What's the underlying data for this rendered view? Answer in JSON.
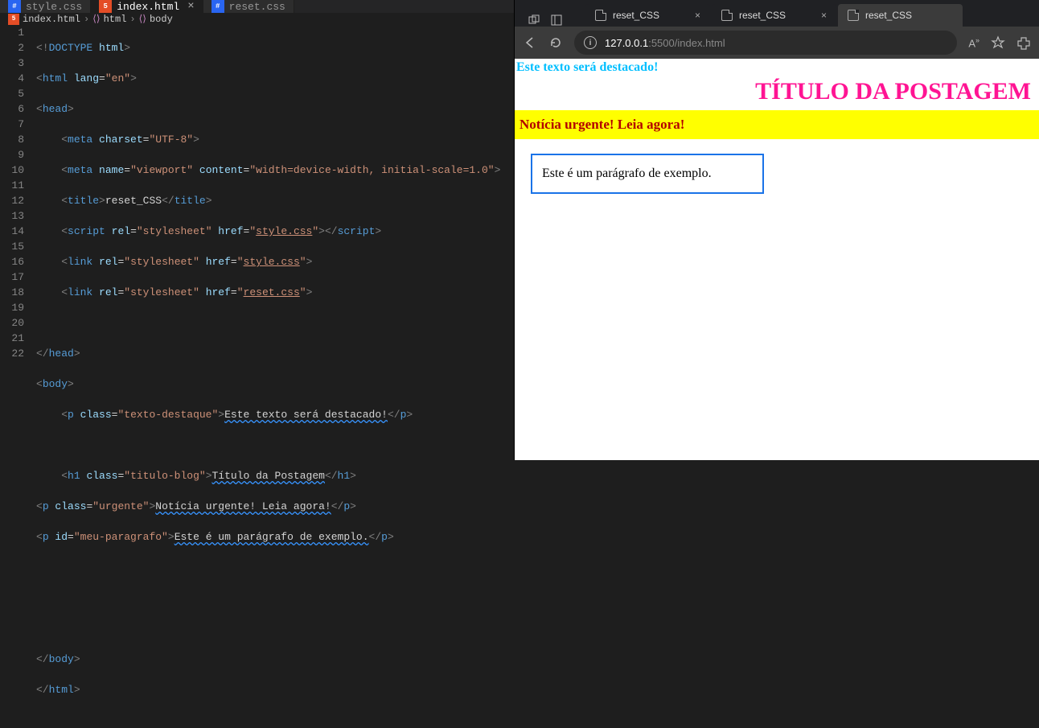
{
  "editor": {
    "tabs": [
      {
        "icon": "css",
        "label": "style.css"
      },
      {
        "icon": "html",
        "label": "index.html",
        "active": true
      },
      {
        "icon": "css",
        "label": "reset.css"
      }
    ],
    "breadcrumb": {
      "file_icon": "html",
      "file": "index.html",
      "path1": "html",
      "path2": "body"
    },
    "code": {
      "l1_a": "<!",
      "l1_b": "DOCTYPE",
      "l1_c": " html",
      "l1_d": ">",
      "l2_a": "<",
      "l2_b": "html",
      "l2_c": " lang",
      "l2_d": "=",
      "l2_e": "\"en\"",
      "l2_f": ">",
      "l3_a": "<",
      "l3_b": "head",
      "l3_c": ">",
      "l4_a": "<",
      "l4_b": "meta",
      "l4_c": " charset",
      "l4_d": "=",
      "l4_e": "\"UTF-8\"",
      "l4_f": ">",
      "l5_a": "<",
      "l5_b": "meta",
      "l5_c": " name",
      "l5_d": "=",
      "l5_e": "\"viewport\"",
      "l5_f": " content",
      "l5_g": "=",
      "l5_h": "\"width=device-width, initial-scale=1.0\"",
      "l5_i": ">",
      "l6_a": "<",
      "l6_b": "title",
      "l6_c": ">",
      "l6_d": "reset_CSS",
      "l6_e": "</",
      "l6_f": "title",
      "l6_g": ">",
      "l7_a": "<",
      "l7_b": "script",
      "l7_c": " rel",
      "l7_d": "=",
      "l7_e": "\"stylesheet\"",
      "l7_f": " href",
      "l7_g": "=",
      "l7_h": "\"",
      "l7_i": "style.css",
      "l7_j": "\"",
      "l7_k": "></",
      "l7_l": "script",
      "l7_m": ">",
      "l8_a": "<",
      "l8_b": "link",
      "l8_c": " rel",
      "l8_d": "=",
      "l8_e": "\"stylesheet\"",
      "l8_f": " href",
      "l8_g": "=",
      "l8_h": "\"",
      "l8_i": "style.css",
      "l8_j": "\"",
      "l8_k": ">",
      "l9_a": "<",
      "l9_b": "link",
      "l9_c": " rel",
      "l9_d": "=",
      "l9_e": "\"stylesheet\"",
      "l9_f": " href",
      "l9_g": "=",
      "l9_h": "\"",
      "l9_i": "reset.css",
      "l9_j": "\"",
      "l9_k": ">",
      "l11_a": "</",
      "l11_b": "head",
      "l11_c": ">",
      "l12_a": "<",
      "l12_b": "body",
      "l12_c": ">",
      "l13_a": "<",
      "l13_b": "p",
      "l13_c": " class",
      "l13_d": "=",
      "l13_e": "\"texto-destaque\"",
      "l13_f": ">",
      "l13_g": "Este texto será destacado!",
      "l13_h": "</",
      "l13_i": "p",
      "l13_j": ">",
      "l15_a": "<",
      "l15_b": "h1",
      "l15_c": " class",
      "l15_d": "=",
      "l15_e": "\"titulo-blog\"",
      "l15_f": ">",
      "l15_g": "Título da Postagem",
      "l15_h": "</",
      "l15_i": "h1",
      "l15_j": ">",
      "l16_a": "<",
      "l16_b": "p",
      "l16_c": " class",
      "l16_d": "=",
      "l16_e": "\"urgente\"",
      "l16_f": ">",
      "l16_g": "Notícia urgente! Leia agora!",
      "l16_h": "</",
      "l16_i": "p",
      "l16_j": ">",
      "l17_a": "<",
      "l17_b": "p",
      "l17_c": " id",
      "l17_d": "=",
      "l17_e": "\"meu-paragrafo\"",
      "l17_f": ">",
      "l17_g": "Este é um parágrafo de exemplo.",
      "l17_h": "</",
      "l17_i": "p",
      "l17_j": ">",
      "l21_a": "</",
      "l21_b": "body",
      "l21_c": ">",
      "l22_a": "</",
      "l22_b": "html",
      "l22_c": ">"
    },
    "line_numbers": [
      "1",
      "2",
      "3",
      "4",
      "5",
      "6",
      "7",
      "8",
      "9",
      "10",
      "11",
      "12",
      "13",
      "14",
      "15",
      "16",
      "17",
      "18",
      "19",
      "20",
      "21",
      "22"
    ]
  },
  "browser": {
    "tabs": [
      {
        "label": "reset_CSS"
      },
      {
        "label": "reset_CSS"
      },
      {
        "label": "reset_CSS"
      }
    ],
    "url_host": "127.0.0.1",
    "url_port": ":5500",
    "url_path": "/index.html",
    "page": {
      "destaque": "Este texto será destacado!",
      "titulo": "TÍTULO DA POSTAGEM",
      "urgente": "Notícia urgente! Leia agora!",
      "paragrafo": "Este é um parágrafo de exemplo."
    }
  }
}
